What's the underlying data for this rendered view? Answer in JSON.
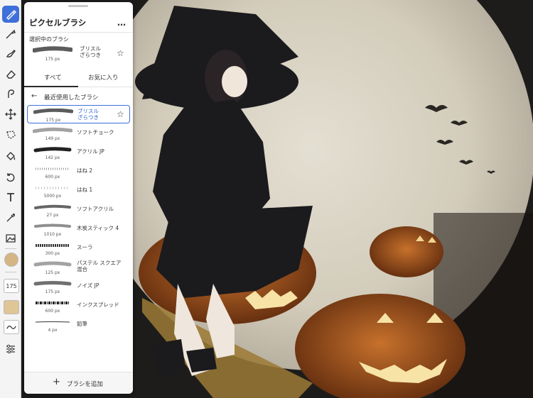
{
  "panel": {
    "title": "ピクセルブラシ",
    "more_icon": "…",
    "selected_section_label": "選択中のブラシ",
    "selected_brush": {
      "name": "ブリスル\nざらつき",
      "size": "175 px"
    },
    "tabs": [
      {
        "label": "すべて",
        "active": true
      },
      {
        "label": "お気に入り",
        "active": false
      }
    ],
    "recent_label": "最近使用したブラシ",
    "brushes": [
      {
        "name": "ブリスル\nざらつき",
        "size": "175 px",
        "selected": true,
        "favorite_icon": "star-outline"
      },
      {
        "name": "ソフトチョーク",
        "size": "149 px"
      },
      {
        "name": "アクリル JP",
        "size": "142 px"
      },
      {
        "name": "はね 2",
        "size": "600 px"
      },
      {
        "name": "はね 1",
        "size": "5000 px"
      },
      {
        "name": "ソフトアクリル",
        "size": "27 px"
      },
      {
        "name": "木炭スティック 4",
        "size": "1010 px"
      },
      {
        "name": "スーラ",
        "size": "300 px"
      },
      {
        "name": "パステル スクエア\n混合",
        "size": "125 px"
      },
      {
        "name": "ノイズ JP",
        "size": "175 px"
      },
      {
        "name": "インクスプレッド",
        "size": "600 px"
      },
      {
        "name": "鉛筆",
        "size": "4 px"
      }
    ],
    "add_button": {
      "icon": "+",
      "label": "ブラシを追加"
    }
  },
  "toolbar": {
    "tools": [
      "pixel-brush-icon",
      "vector-brush-icon",
      "fill-brush-icon",
      "eraser-icon",
      "smudge-icon",
      "move-icon",
      "lasso-icon",
      "paint-bucket-icon",
      "undo-history-icon",
      "text-icon",
      "eyedropper-icon",
      "image-icon"
    ],
    "color_hex": "#d4b583",
    "size_value": "175",
    "opacity_hex": "#e0c595"
  },
  "colors": {
    "accent": "#3f6fd8",
    "moon": "#d9d4c4",
    "pumpkin": "#b2561a"
  }
}
